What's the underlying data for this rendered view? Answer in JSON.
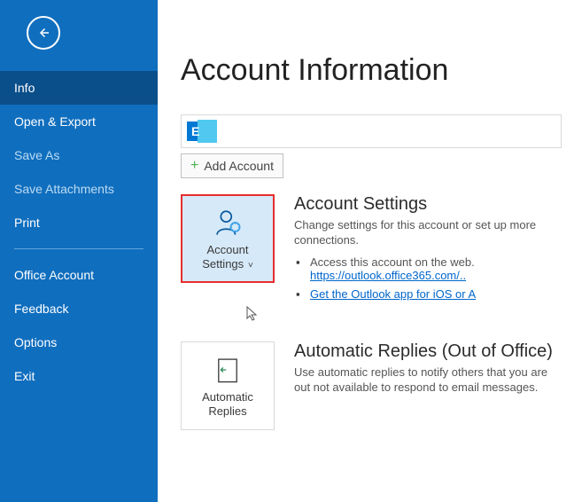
{
  "sidebar": {
    "items": [
      {
        "label": "Info"
      },
      {
        "label": "Open & Export"
      },
      {
        "label": "Save As"
      },
      {
        "label": "Save Attachments"
      },
      {
        "label": "Print"
      },
      {
        "label": "Office Account"
      },
      {
        "label": "Feedback"
      },
      {
        "label": "Options"
      },
      {
        "label": "Exit"
      }
    ]
  },
  "main": {
    "title": "Account Information",
    "add_account_label": "Add Account",
    "account_settings": {
      "tile_label": "Account Settings",
      "heading": "Account Settings",
      "description": "Change settings for this account or set up more connections.",
      "bullets": [
        {
          "text": "Access this account on the web."
        },
        {
          "text": ""
        }
      ],
      "link1": "https://outlook.office365.com/..",
      "link2": "Get the Outlook app for iOS or A"
    },
    "auto_replies": {
      "tile_label": "Automatic Replies",
      "heading": "Automatic Replies (Out of Office)",
      "description": "Use automatic replies to notify others that you are out not available to respond to email messages."
    }
  }
}
